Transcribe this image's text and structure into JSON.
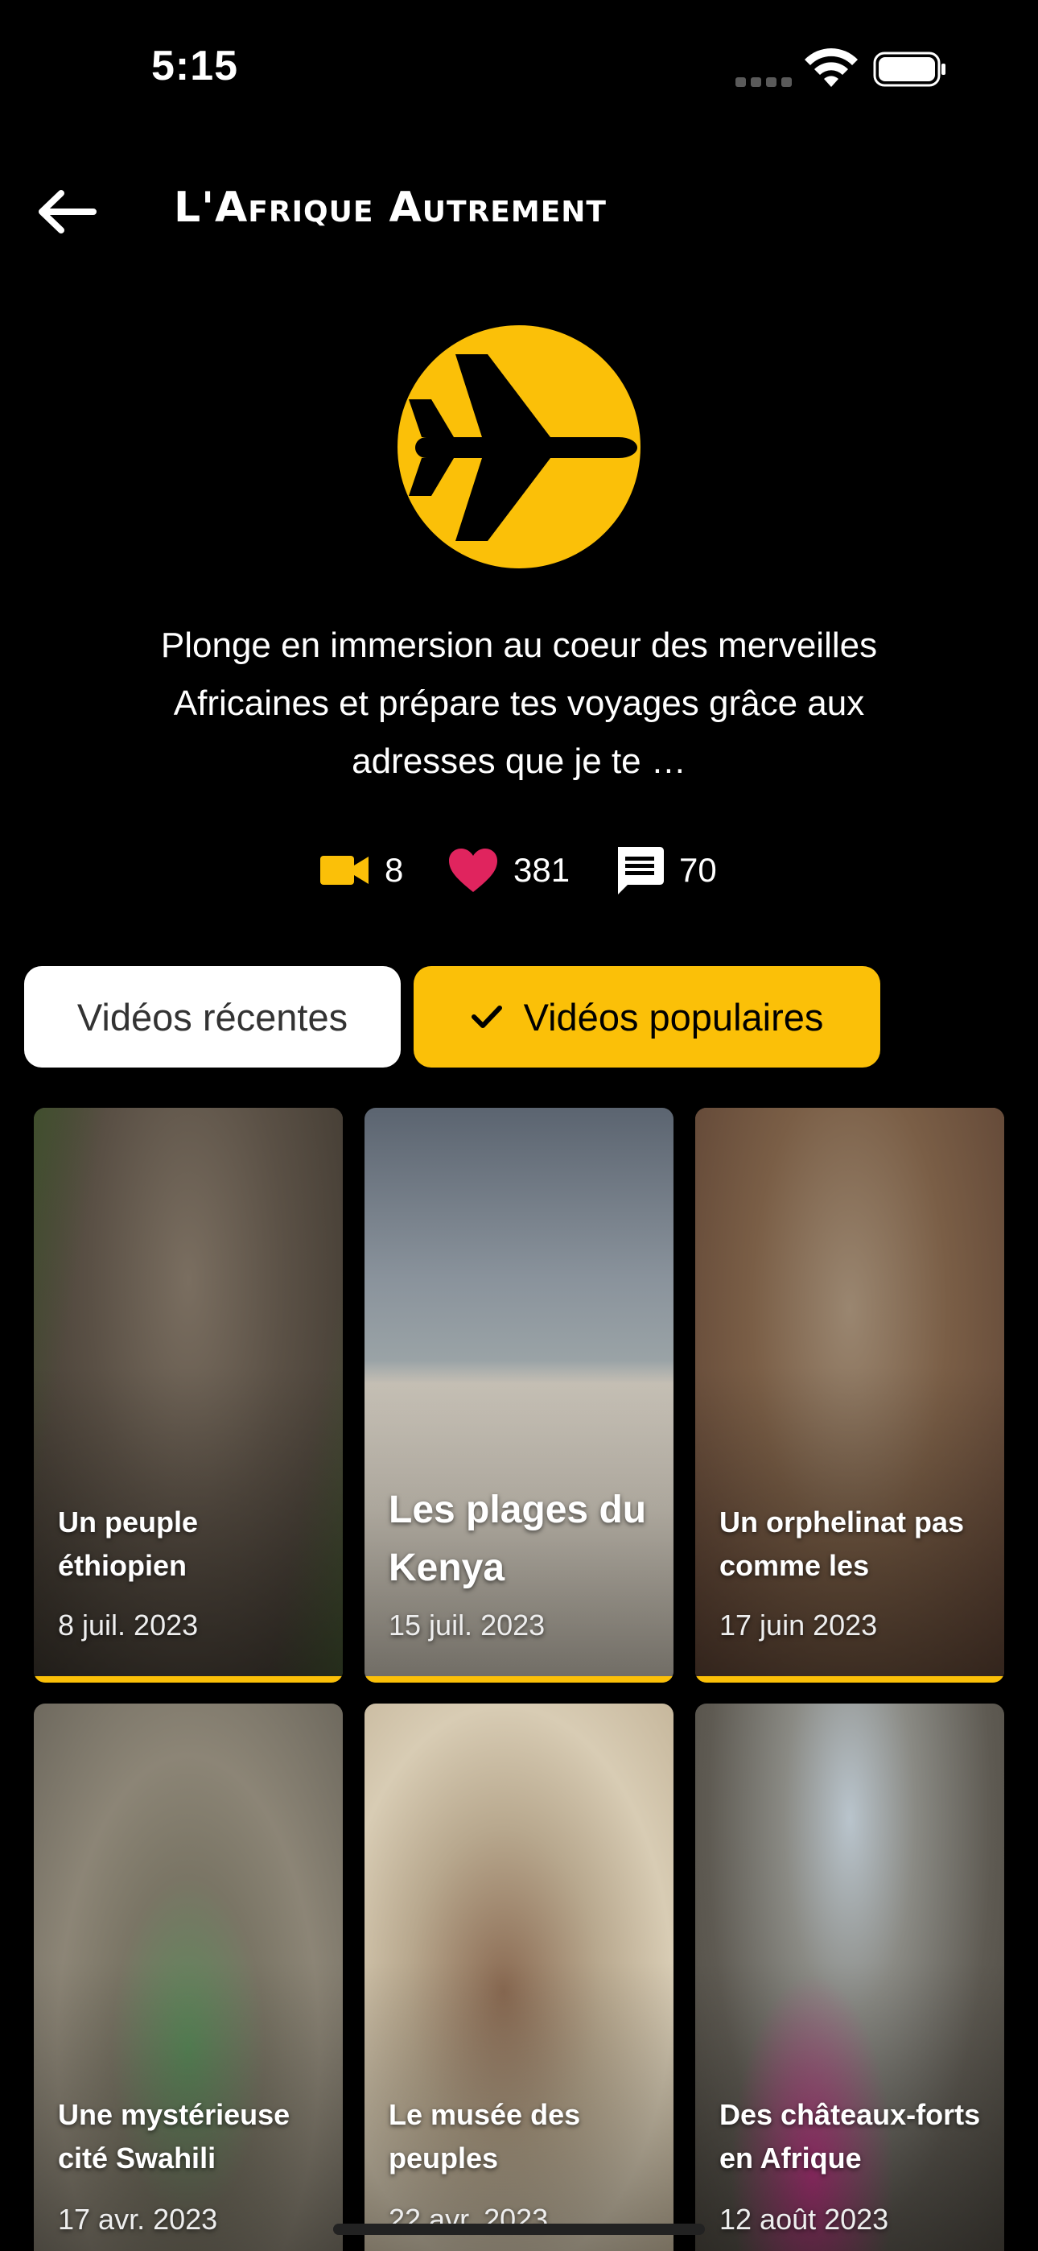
{
  "status_bar": {
    "time": "5:15"
  },
  "nav": {
    "title": "L'Afrique Autrement"
  },
  "channel": {
    "description": "Plonge en immersion au coeur des merveilles Africaines et prépare tes voyages grâce aux adresses que je te …",
    "stats": {
      "videos": "8",
      "likes": "381",
      "comments": "70"
    }
  },
  "tabs": {
    "recent": "Vidéos récentes",
    "popular": "Vidéos populaires"
  },
  "videos": [
    {
      "title": "Un peuple éthiopien",
      "date": "8 juil. 2023"
    },
    {
      "title": "Les plages du Kenya",
      "date": "15 juil. 2023"
    },
    {
      "title": "Un orphelinat pas comme les",
      "date": "17 juin 2023"
    },
    {
      "title": "Une mystérieuse cité Swahili",
      "date": "17 avr. 2023"
    },
    {
      "title": "Le musée des peuples",
      "date": "22 avr. 2023"
    },
    {
      "title": "Des châteaux-forts en Afrique",
      "date": "12 août 2023"
    }
  ],
  "colors": {
    "accent": "#FBC008",
    "heart": "#E0245E",
    "background": "#000000"
  },
  "icons": [
    "back-arrow-icon",
    "airplane-icon",
    "video-camera-icon",
    "heart-icon",
    "comment-icon",
    "check-icon",
    "wifi-icon",
    "battery-icon"
  ]
}
